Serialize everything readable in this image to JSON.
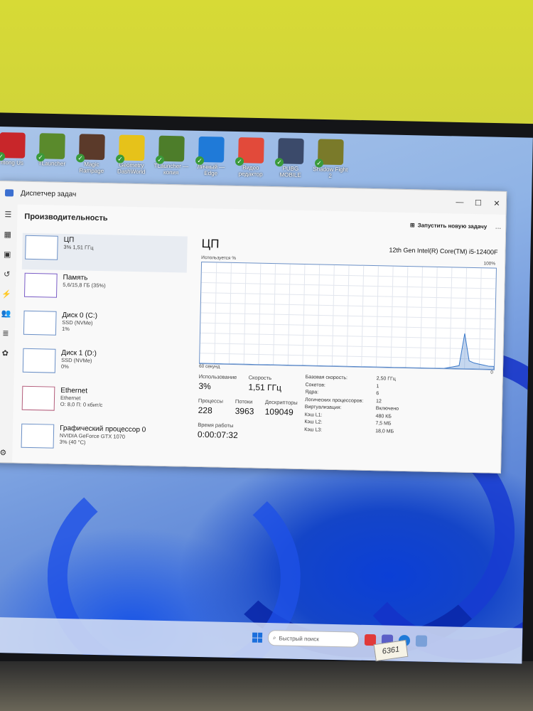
{
  "desktop_icons": [
    {
      "label": "mong Us",
      "color": "#c8262a"
    },
    {
      "label": "TLauncher",
      "color": "#5a8a2c"
    },
    {
      "label": "Magic Rampage",
      "color": "#5b3a2a"
    },
    {
      "label": "Geometry DashWorld",
      "color": "#e6c21a"
    },
    {
      "label": "TLauncher — копия",
      "color": "#4d7d2a"
    },
    {
      "label": "Личный — Edge",
      "color": "#1f7ad8"
    },
    {
      "label": "Видео редактор",
      "color": "#e24a3a"
    },
    {
      "label": "PUBG MOBILE",
      "color": "#3b4a6a"
    },
    {
      "label": "Shadow Fight 2",
      "color": "#7a7a2a"
    }
  ],
  "window": {
    "title": "Диспетчер задач",
    "controls": {
      "minimize": "—",
      "maximize": "☐",
      "close": "✕"
    }
  },
  "nav_icons": [
    "hamburger-icon",
    "processes-icon",
    "performance-icon",
    "history-icon",
    "startup-icon",
    "users-icon",
    "details-icon",
    "services-icon",
    "settings-icon"
  ],
  "header": {
    "title": "Производительность",
    "new_task": "Запустить новую задачу",
    "more": "..."
  },
  "sidebar": [
    {
      "name": "ЦП",
      "sub1": "3% 1,51 ГГц",
      "sub2": "",
      "selected": true
    },
    {
      "name": "Память",
      "sub1": "5,6/15,8 ГБ (35%)",
      "sub2": "",
      "selected": false
    },
    {
      "name": "Диск 0 (C:)",
      "sub1": "SSD (NVMe)",
      "sub2": "1%",
      "selected": false
    },
    {
      "name": "Диск 1 (D:)",
      "sub1": "SSD (NVMe)",
      "sub2": "0%",
      "selected": false
    },
    {
      "name": "Ethernet",
      "sub1": "Ethernet",
      "sub2": "О: 8,0 П: 0 кбит/с",
      "selected": false
    },
    {
      "name": "Графический процессор 0",
      "sub1": "NVIDIA GeForce GTX 1070",
      "sub2": "3% (40 °C)",
      "selected": false
    }
  ],
  "cpu": {
    "title": "ЦП",
    "model": "12th Gen Intel(R) Core(TM) i5-12400F",
    "graph_label": "Используется %",
    "graph_max": "100%",
    "graph_time": "60 секунд",
    "graph_min": "0",
    "utilization_label": "Использование",
    "utilization": "3%",
    "speed_label": "Скорость",
    "speed": "1,51 ГГц",
    "processes_label": "Процессы",
    "processes": "228",
    "threads_label": "Потоки",
    "threads": "3963",
    "handles_label": "Дескрипторы",
    "handles": "109049",
    "uptime_label": "Время работы",
    "uptime": "0:00:07:32",
    "specs": [
      {
        "k": "Базовая скорость:",
        "v": "2,50 ГГц"
      },
      {
        "k": "Сокетов:",
        "v": "1"
      },
      {
        "k": "Ядра:",
        "v": "6"
      },
      {
        "k": "Логических процессоров:",
        "v": "12"
      },
      {
        "k": "Виртуализация:",
        "v": "Включено"
      },
      {
        "k": "Кэш L1:",
        "v": "480 КБ"
      },
      {
        "k": "Кэш L2:",
        "v": "7,5 МБ"
      },
      {
        "k": "Кэш L3:",
        "v": "18,0 МБ"
      }
    ]
  },
  "chart_data": {
    "type": "area",
    "ylim": [
      0,
      100
    ],
    "y": [
      0,
      0,
      0,
      0,
      0,
      0,
      0,
      0,
      0,
      0,
      0,
      0,
      0,
      0,
      0,
      0,
      0,
      0,
      0,
      0,
      0,
      0,
      0,
      0,
      0,
      0,
      0,
      0,
      0,
      0,
      0,
      0,
      0,
      0,
      0,
      0,
      0,
      0,
      0,
      0,
      0,
      0,
      0,
      0,
      0,
      0,
      0,
      0,
      0,
      0,
      1,
      2,
      3,
      35,
      8,
      6,
      5,
      4,
      3,
      3
    ]
  },
  "taskbar": {
    "search_placeholder": "Быстрый поиск"
  },
  "sticker": "6361"
}
